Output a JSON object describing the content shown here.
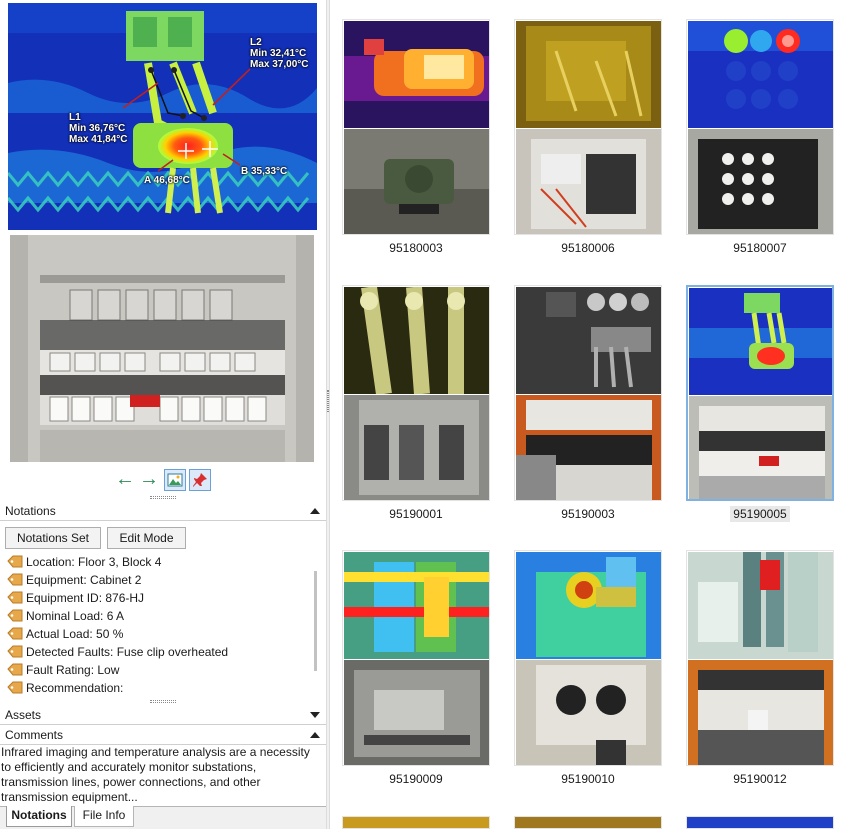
{
  "preview": {
    "labels": {
      "l2_name": "L2",
      "l2_min": "Min  32,41°C",
      "l2_max": "Max  37,00°C",
      "l1_name": "L1",
      "l1_min": "Min  36,76°C",
      "l1_max": "Max  41,84°C",
      "point_a": "A 46,68°C",
      "point_b": "B 35,33°C"
    }
  },
  "nav": {
    "prev_icon": "arrow-left-icon",
    "next_icon": "arrow-right-icon",
    "image_toggle_icon": "image-icon",
    "pin_icon": "pin-icon"
  },
  "notations": {
    "header": "Notations",
    "set_button": "Notations Set",
    "edit_button": "Edit Mode",
    "items": [
      "Location: Floor 3, Block 4",
      "Equipment: Cabinet 2",
      "Equipment ID: 876-HJ",
      "Nominal Load: 6 A",
      "Actual Load: 50 %",
      "Detected Faults: Fuse clip overheated",
      "Fault Rating: Low",
      "Recommendation:"
    ]
  },
  "assets": {
    "header": "Assets"
  },
  "comments": {
    "header": "Comments",
    "text": "Infrared imaging and temperature analysis are a necessity to efficiently and accurately monitor substations, transmission lines, power connections, and other transmission equipment..."
  },
  "tabs": [
    "Notations",
    "File Info"
  ],
  "thumbnails": [
    {
      "id": "95180003"
    },
    {
      "id": "95180006"
    },
    {
      "id": "95180007"
    },
    {
      "id": "95190001"
    },
    {
      "id": "95190003"
    },
    {
      "id": "95190005",
      "selected": true
    },
    {
      "id": "95190009"
    },
    {
      "id": "95190010"
    },
    {
      "id": "95190012"
    }
  ],
  "colors": {
    "selection_border": "#7fb2e0",
    "nav_arrow": "#2e8b57"
  }
}
